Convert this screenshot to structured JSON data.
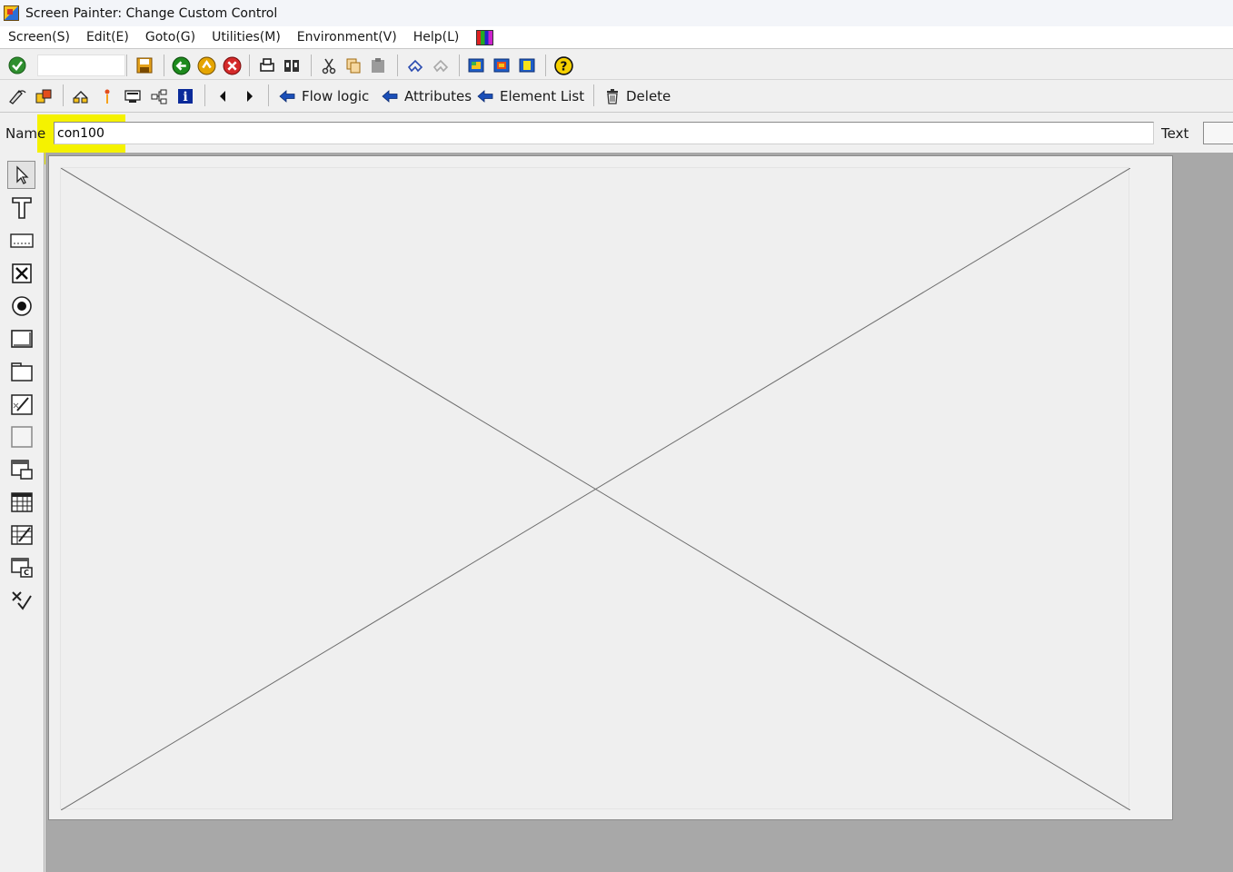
{
  "window": {
    "title": "Screen Painter:  Change Custom Control"
  },
  "menu": [
    {
      "label": "Screen(S)"
    },
    {
      "label": "Edit(E)"
    },
    {
      "label": "Goto(G)"
    },
    {
      "label": "Utilities(M)"
    },
    {
      "label": "Environment(V)"
    },
    {
      "label": "Help(L)"
    }
  ],
  "toolbar2": {
    "flow_logic": "Flow logic",
    "attributes": "Attributes",
    "element_list": "Element List",
    "delete": "Delete"
  },
  "element": {
    "name_label": "Name",
    "name_value": "con100",
    "text_label": "Text",
    "text_value": ""
  },
  "colors": {
    "highlight": "#f5f200",
    "workspace": "#a8a8a8",
    "arrow_blue": "#1b4fb8"
  }
}
